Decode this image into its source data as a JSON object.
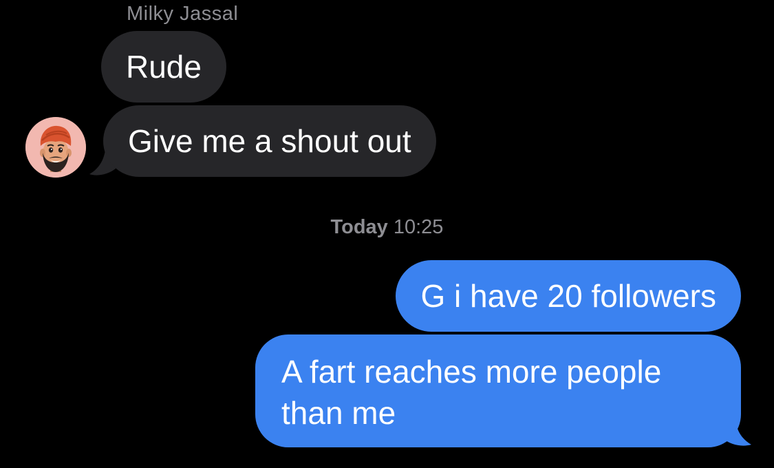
{
  "conversation": {
    "sender_name": "Milky Jassal",
    "timestamp": {
      "day": "Today",
      "time": "10:25"
    },
    "messages": [
      {
        "direction": "incoming",
        "text": "Rude"
      },
      {
        "direction": "incoming",
        "text": "Give me a shout out"
      },
      {
        "direction": "outgoing",
        "text": "G i have 20 followers"
      },
      {
        "direction": "outgoing",
        "text": "A fart reaches more people than me"
      }
    ]
  },
  "avatar": {
    "icon": "memoji-avatar-icon",
    "background": "#f2b8b0"
  },
  "colors": {
    "background": "#000000",
    "incoming_bubble": "#262629",
    "outgoing_bubble": "#3b82f0",
    "meta_text": "#8e8e93"
  }
}
